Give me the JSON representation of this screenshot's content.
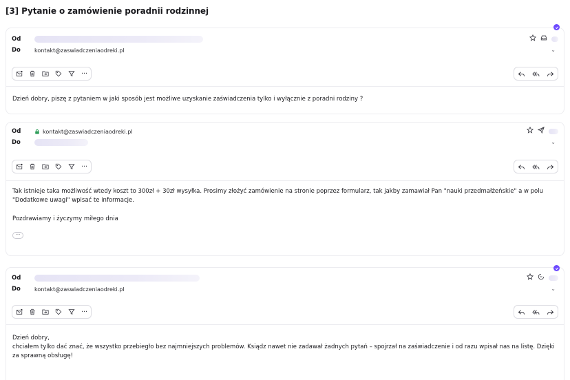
{
  "thread": {
    "title": "[3] Pytanie o zamówienie poradnii rodzinnej"
  },
  "labels": {
    "from": "Od",
    "to": "Do"
  },
  "messages": [
    {
      "to": "kontakt@zaswiadczeniaodreki.pl",
      "body": [
        "Dzień dobry, piszę z pytaniem w jaki sposób jest możliwe uzyskanie zaświadczenia tylko i wyłącznie z poradni rodziny ?"
      ]
    },
    {
      "from": "kontakt@zaswiadczeniaodreki.pl",
      "body": [
        "Tak istnieje taka możliwość wtedy koszt to 300zł + 30zł wysyłka. Prosimy złożyć zamówienie na stronie poprzez formularz, tak jakby zamawiał Pan \"nauki przedmałżeńskie\" a w polu \"Dodatkowe uwagi\" wpisać te informacje.",
        "Pozdrawiamy i życzymy miłego dnia"
      ],
      "more_label": "···"
    },
    {
      "to": "kontakt@zaswiadczeniaodreki.pl",
      "body": [
        "Dzień dobry,",
        "chciałem tylko dać znać, że wszystko przebiegło bez najmniejszych problemów. Ksiądz nawet nie zadawał żadnych pytań – spojrzał na zaświadczenie i od razu wpisał nas na listę. Dzięki za sprawną obsługę!"
      ]
    }
  ],
  "toolbar": {
    "more": "···"
  },
  "colors": {
    "accent": "#6d4aff",
    "border": "#ececf0",
    "blur": "#e6e4f5"
  }
}
